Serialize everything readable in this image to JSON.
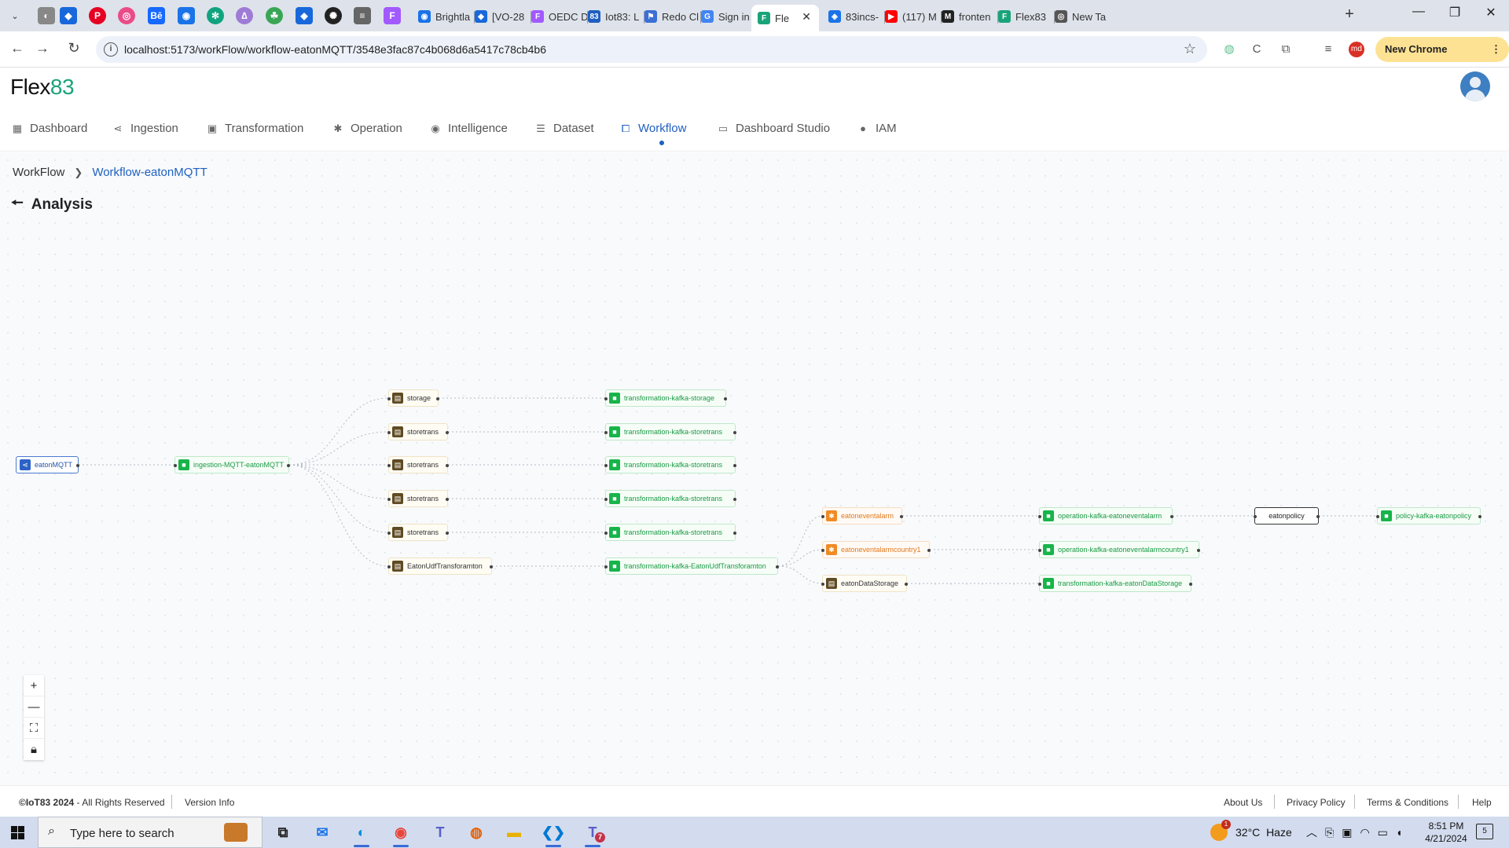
{
  "browser": {
    "tabs": [
      {
        "label": "Brightla",
        "icon": "brightlayer-icon",
        "color": "#1a73e8"
      },
      {
        "label": "[VO-28",
        "icon": "jira-icon",
        "color": "#1868db"
      },
      {
        "label": "OEDC D",
        "icon": "figma-icon",
        "color": "#a259ff"
      },
      {
        "label": "Iot83: L",
        "icon": "iot83-icon",
        "color": "#1f5fbf"
      },
      {
        "label": "Redo Cl",
        "icon": "redo-icon",
        "color": "#3b6fd6"
      },
      {
        "label": "Sign in",
        "icon": "google-icon",
        "color": "#4285f4"
      },
      {
        "label": "Fle",
        "icon": "flex83-icon",
        "color": "#1aa37a",
        "active": true
      },
      {
        "label": "83incs-",
        "icon": "bookmark-icon",
        "color": "#1a73e8"
      },
      {
        "label": "(117) M",
        "icon": "youtube-icon",
        "color": "#ff0000"
      },
      {
        "label": "fronten",
        "icon": "medium-icon",
        "color": "#222222"
      },
      {
        "label": "Flex83",
        "icon": "flex83-icon",
        "color": "#1aa37a"
      },
      {
        "label": "New Ta",
        "icon": "chrome-icon",
        "color": "#555555"
      }
    ],
    "url": "localhost:5173/workFlow/workflow-eatonMQTT/3548e3fac87c4b068d6a5417c78cb4b6",
    "profile_initials": "md",
    "update_label": "New Chrome available"
  },
  "app": {
    "logo_text": "Flex",
    "logo_number": "83",
    "nav": [
      {
        "label": "Dashboard",
        "icon": "grid-icon"
      },
      {
        "label": "Ingestion",
        "icon": "share-icon"
      },
      {
        "label": "Transformation",
        "icon": "transform-icon"
      },
      {
        "label": "Operation",
        "icon": "cog-icon"
      },
      {
        "label": "Intelligence",
        "icon": "brain-icon"
      },
      {
        "label": "Dataset",
        "icon": "database-icon"
      },
      {
        "label": "Workflow",
        "icon": "workflow-icon",
        "active": true
      },
      {
        "label": "Dashboard Studio",
        "icon": "monitor-icon"
      },
      {
        "label": "IAM",
        "icon": "user-icon"
      }
    ]
  },
  "breadcrumb": {
    "root": "WorkFlow",
    "current": "Workflow-eatonMQTT"
  },
  "section_title": "Analysis",
  "workflow": {
    "nodes": {
      "source": "eatonMQTT",
      "ingestion": "ingestion-MQTT-eatonMQTT",
      "storage": "storage",
      "storetrans": "storetrans",
      "udf": "EatonUdfTransforamton",
      "t_storage": "transformation-kafka-storage",
      "t_storetrans": "transformation-kafka-storetrans",
      "t_udf": "transformation-kafka-EatonUdfTransforamton",
      "alarm": "eatoneventalarm",
      "alarm_country": "eatoneventalarmcountry1",
      "data_storage": "eatonDataStorage",
      "op_alarm": "operation-kafka-eatoneventalarm",
      "op_alarm_country": "operation-kafka-eatoneventalarmcountry1",
      "t_data_storage": "transformation-kafka-eatonDataStorage",
      "policy": "eatonpolicy",
      "policy_kafka": "policy-kafka-eatonpolicy"
    }
  },
  "footer": {
    "copyright_brand": "©IoT83 2024",
    "copyright_rest": " - All Rights Reserved",
    "version": "Version Info",
    "links": [
      "About Us",
      "Privacy Policy",
      "Terms & Conditions",
      "Help"
    ]
  },
  "taskbar": {
    "search_placeholder": "Type here to search",
    "weather_temp": "32°C",
    "weather_desc": "Haze",
    "time": "8:51 PM",
    "date": "4/21/2024",
    "notification_count": "5",
    "weather_alert": "1",
    "teams_badge": "7"
  }
}
